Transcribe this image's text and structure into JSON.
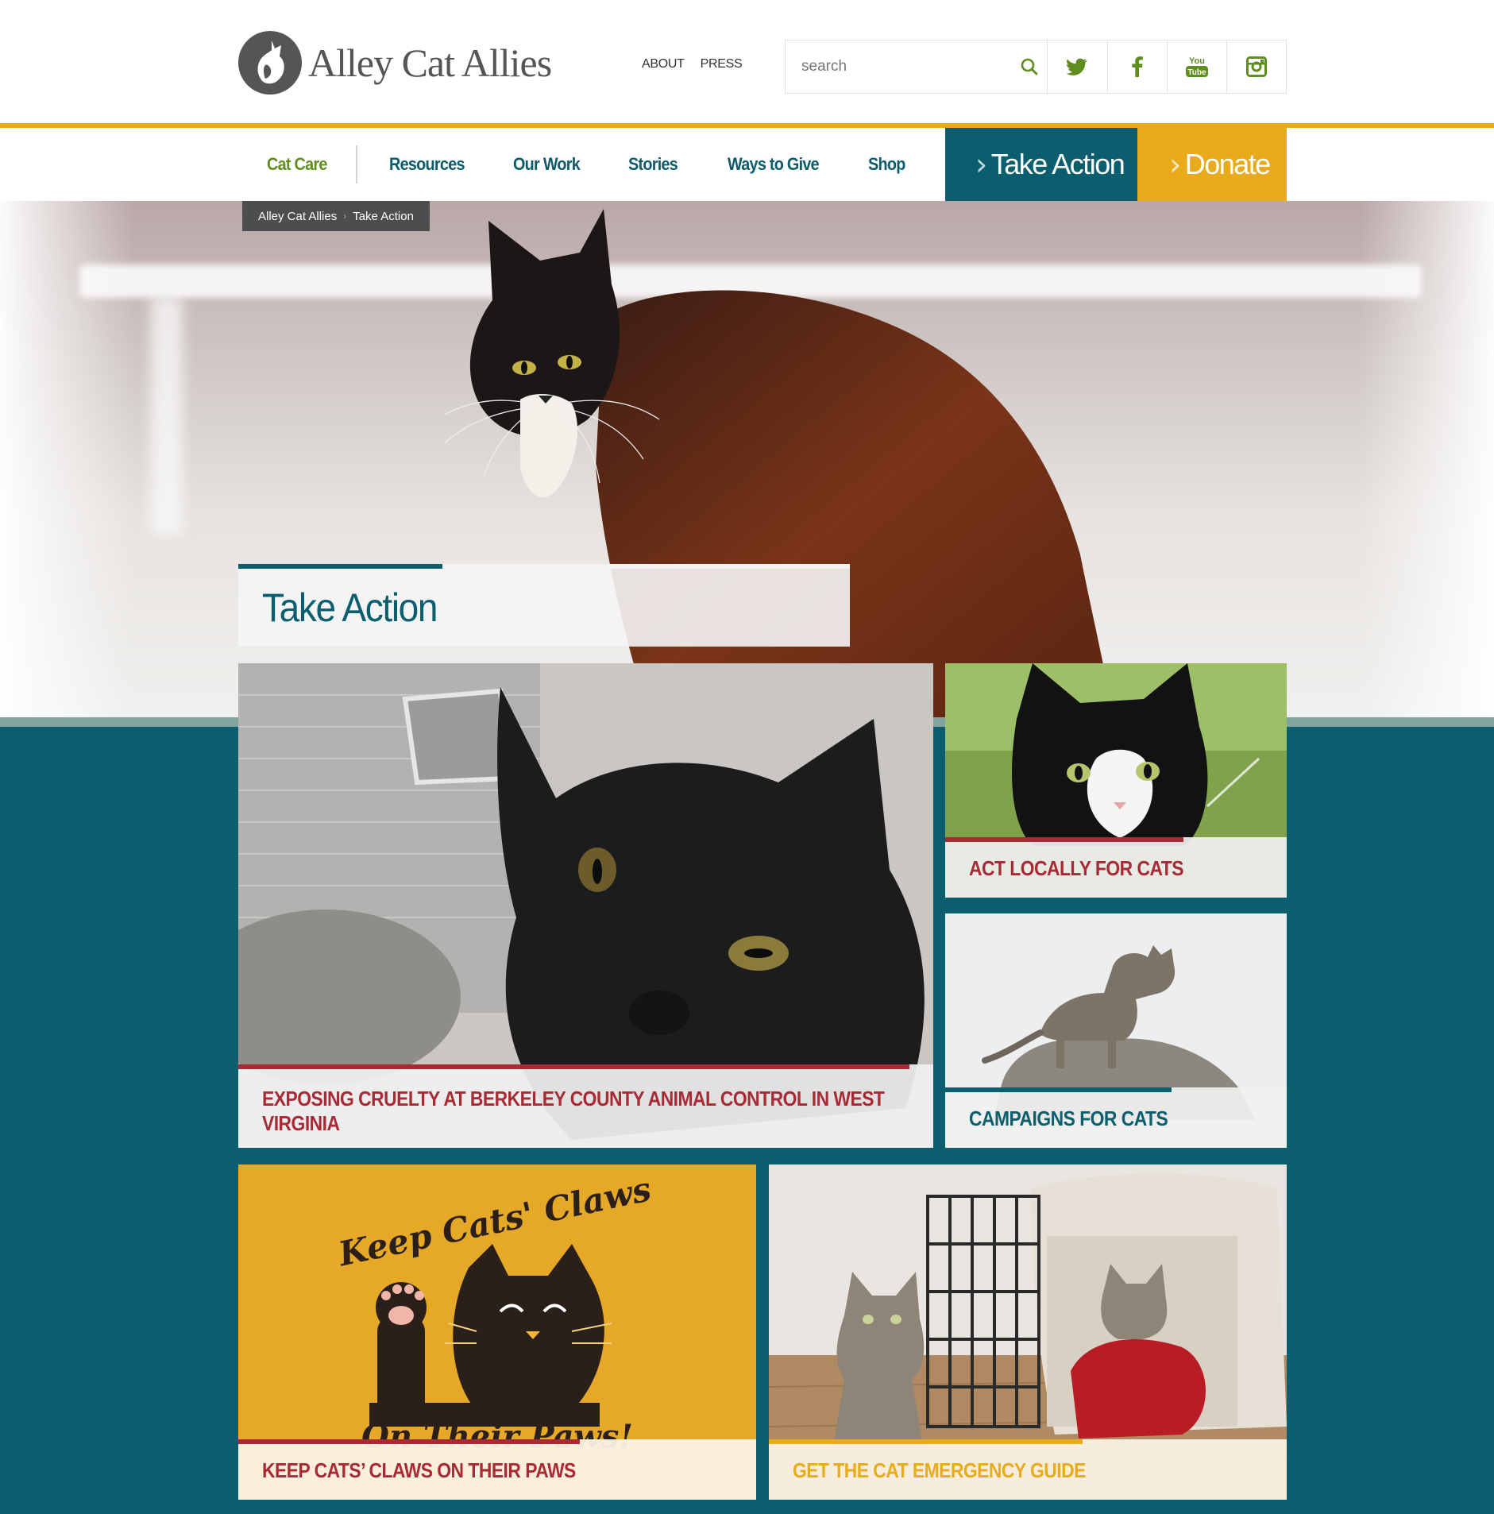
{
  "header": {
    "logo_text": "Alley Cat Allies",
    "top_links": [
      "ABOUT",
      "PRESS"
    ],
    "search_placeholder": "search",
    "social": [
      "twitter-icon",
      "facebook-icon",
      "youtube-icon",
      "instagram-icon"
    ]
  },
  "nav": {
    "items": [
      "Cat Care",
      "Resources",
      "Our Work",
      "Stories",
      "Ways to Give",
      "Shop"
    ],
    "take_action": "Take Action",
    "donate": "Donate"
  },
  "breadcrumb": {
    "home": "Alley Cat Allies",
    "current": "Take Action"
  },
  "hero": {
    "title": "Take Action"
  },
  "cards": [
    {
      "title": "EXPOSING CRUELTY AT BERKELEY COUNTY ANIMAL CONTROL IN WEST VIRGINIA"
    },
    {
      "title": "ACT LOCALLY FOR CATS"
    },
    {
      "title": "CAMPAIGNS FOR CATS"
    },
    {
      "title": "KEEP CATS’ CLAWS ON THEIR PAWS",
      "art_top": "Keep Cats' Claws",
      "art_bottom": "On Their Paws!"
    },
    {
      "title": "GET THE CAT EMERGENCY GUIDE"
    }
  ],
  "colors": {
    "teal": "#0b5e6e",
    "gold": "#e8ab1b",
    "green": "#5f8d1f",
    "red": "#a82a35"
  }
}
